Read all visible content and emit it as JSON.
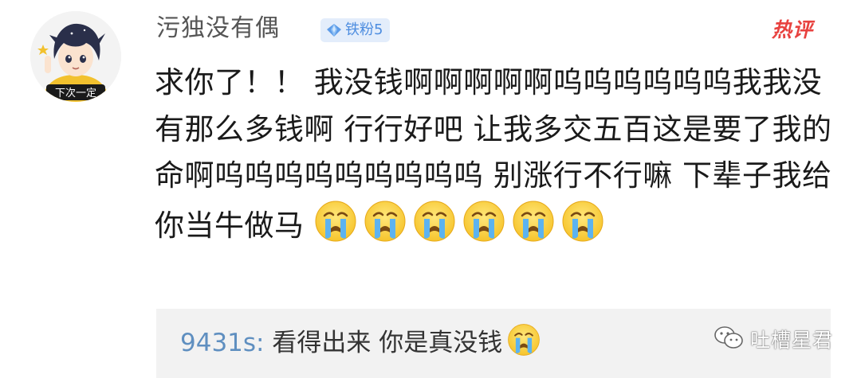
{
  "post": {
    "username": "污独没有偶",
    "fan_badge": "铁粉5",
    "hot_tag": "热评",
    "avatar_caption": "下次一定",
    "comment_text": "求你了！！ 我没钱啊啊啊啊啊呜呜呜呜呜呜我我没有那么多钱啊 行行好吧  让我多交五百这是要了我的命啊呜呜呜呜呜呜呜呜呜  别涨行不行嘛  下辈子我给你当牛做马",
    "trailing_emojis": [
      "crying-face",
      "crying-face",
      "crying-face",
      "crying-face",
      "crying-face",
      "crying-face"
    ]
  },
  "reply": {
    "user": "9431s:",
    "text": " 看得出来 你是真没钱",
    "emoji": "crying-face"
  },
  "watermark": {
    "text": "吐槽星君"
  },
  "colors": {
    "username": "#555555",
    "badge_bg": "#e3edfb",
    "badge_text": "#4d8de0",
    "hot_tag": "#e8423f",
    "reply_user": "#5f8fc0",
    "reply_bg": "#f2f2f2"
  }
}
